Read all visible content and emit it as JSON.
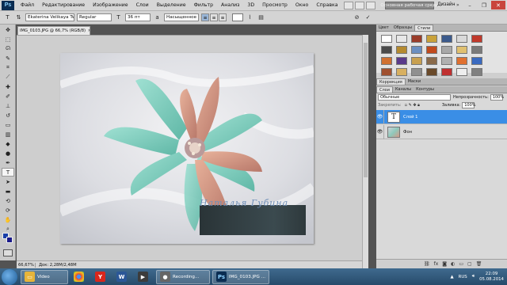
{
  "menu": {
    "logo": "Ps",
    "items": [
      "Файл",
      "Редактирование",
      "Изображение",
      "Слои",
      "Выделение",
      "Фильтр",
      "Анализ",
      "3D",
      "Просмотр",
      "Окно",
      "Справка"
    ],
    "workspace": "Основная рабочая среда",
    "design": "Дизайн",
    "more": "»"
  },
  "options": {
    "font_family": "Ekaterina Velikaya Two",
    "font_style": "Regular",
    "font_size": "36 пт",
    "antialias": "Насыщенное"
  },
  "document": {
    "tab_title": "IMG_0103.JPG @ 66,7% (RGB/8)",
    "zoom": "66,67%",
    "doc_size": "Док: 2,28M/2,48M",
    "signature": "Наталья Губина"
  },
  "panels": {
    "top_tabs": [
      "Цвет",
      "Образцы",
      "Стили"
    ],
    "mid_tabs": [
      "Коррекция",
      "Маски"
    ],
    "layer_tabs": [
      "Слои",
      "Каналы",
      "Контуры"
    ],
    "blend_mode": "Обычные",
    "opacity_label": "Непрозрачность:",
    "opacity_value": "100%",
    "lock_label": "Закрепить:",
    "fill_label": "Заливка:",
    "fill_value": "100%",
    "style_colors": [
      "#ffffff",
      "#e8e8e8",
      "#9a3c2a",
      "#c9a23a",
      "#3b5a8c",
      "#d9d9d9",
      "#c0392b",
      "#4a4a4a",
      "#b58a2f",
      "#6b8fc1",
      "#c14a1c",
      "#a8a8a8",
      "#e0c070",
      "#7a7a7a",
      "#d07030",
      "#5a3a8a",
      "#c8a050",
      "#8a6a4a",
      "#b0b0b0",
      "#e07030",
      "#3a6ac0",
      "#a05030",
      "#d8b060",
      "#909090",
      "#6a4a2a",
      "#c03030",
      "#eeeeee",
      "#808080"
    ],
    "layers": [
      {
        "name": "Слой 1",
        "thumb": "T",
        "selected": true
      },
      {
        "name": "Фон",
        "thumb": "",
        "selected": false
      }
    ]
  },
  "taskbar": {
    "video_label": "Video",
    "recording_label": "Recording...",
    "ps_label": "IMG_0103.JPG ...",
    "lang": "RUS",
    "time": "22:09",
    "date": "05.08.2014"
  }
}
